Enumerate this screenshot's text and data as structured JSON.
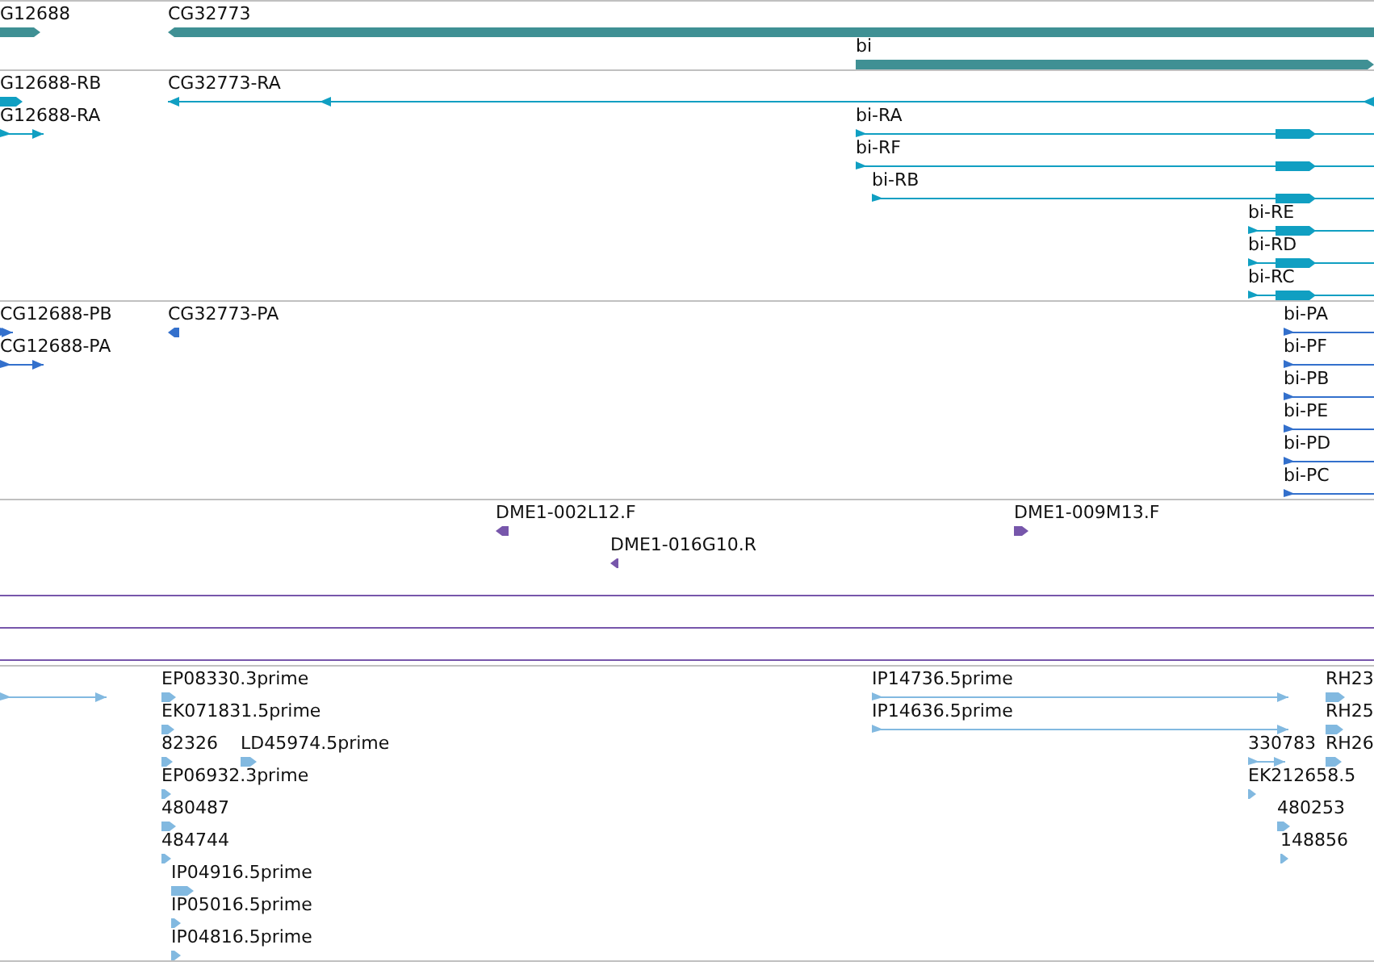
{
  "tracks": [
    {
      "color": "#3f9094",
      "features": [
        {
          "label": "G12688",
          "kind": "bar",
          "reverse": false
        },
        {
          "label": "CG32773",
          "kind": "bar",
          "reverse": true
        },
        {
          "label": "bi",
          "kind": "bar",
          "reverse": false
        }
      ]
    },
    {
      "color": "#109fc2",
      "features": [
        {
          "label": "G12688-RB",
          "kind": "bar",
          "reverse": false
        },
        {
          "label": "CG32773-RA",
          "kind": "line",
          "reverse": true
        },
        {
          "label": "G12688-RA",
          "kind": "line",
          "reverse": false
        },
        {
          "label": "bi-RA",
          "kind": "exon-line",
          "reverse": false
        },
        {
          "label": "bi-RF",
          "kind": "exon-line",
          "reverse": false
        },
        {
          "label": "bi-RB",
          "kind": "exon-line",
          "reverse": false
        },
        {
          "label": "bi-RE",
          "kind": "exon-line",
          "reverse": false
        },
        {
          "label": "bi-RD",
          "kind": "exon-line",
          "reverse": false
        },
        {
          "label": "bi-RC",
          "kind": "exon-line",
          "reverse": false
        }
      ]
    },
    {
      "color": "#3370cc",
      "features": [
        {
          "label": "CG12688-PB",
          "kind": "line",
          "reverse": false
        },
        {
          "label": "CG32773-PA",
          "kind": "bar",
          "reverse": true
        },
        {
          "label": "CG12688-PA",
          "kind": "line",
          "reverse": false
        },
        {
          "label": "bi-PA",
          "kind": "exon-line",
          "reverse": false
        },
        {
          "label": "bi-PF",
          "kind": "exon-line",
          "reverse": false
        },
        {
          "label": "bi-PB",
          "kind": "exon-line",
          "reverse": false
        },
        {
          "label": "bi-PE",
          "kind": "exon-line",
          "reverse": false
        },
        {
          "label": "bi-PD",
          "kind": "exon-line",
          "reverse": false
        },
        {
          "label": "bi-PC",
          "kind": "exon-line",
          "reverse": false
        }
      ]
    },
    {
      "color": "#7756ab",
      "features": [
        {
          "label": "DME1-002L12.F",
          "kind": "bar",
          "reverse": true
        },
        {
          "label": "DME1-009M13.F",
          "kind": "bar",
          "reverse": false
        },
        {
          "label": "DME1-016G10.R",
          "kind": "bar",
          "reverse": true
        },
        {
          "kind": "plain-line"
        },
        {
          "kind": "plain-line"
        },
        {
          "kind": "plain-line"
        }
      ]
    },
    {
      "color": "#82b9e0",
      "features": [
        {
          "kind": "line",
          "reverse": false
        },
        {
          "label": "EP08330.3prime",
          "kind": "bar",
          "reverse": false
        },
        {
          "label": "IP14736.5prime",
          "kind": "line",
          "reverse": false
        },
        {
          "label": "RH23",
          "kind": "bar",
          "reverse": false
        },
        {
          "label": "EK071831.5prime",
          "kind": "bar",
          "reverse": false
        },
        {
          "label": "IP14636.5prime",
          "kind": "line",
          "reverse": false
        },
        {
          "label": "RH25",
          "kind": "bar",
          "reverse": false
        },
        {
          "label": "82326",
          "kind": "bar",
          "reverse": false
        },
        {
          "label": "LD45974.5prime",
          "kind": "bar",
          "reverse": false
        },
        {
          "label": "330783",
          "kind": "line",
          "reverse": false
        },
        {
          "label": "RH26",
          "kind": "bar",
          "reverse": false
        },
        {
          "label": "EP06932.3prime",
          "kind": "bar",
          "reverse": false
        },
        {
          "label": "EK212658.5",
          "kind": "bar",
          "reverse": false
        },
        {
          "label": "480487",
          "kind": "bar",
          "reverse": false
        },
        {
          "label": "480253",
          "kind": "bar",
          "reverse": false
        },
        {
          "label": "484744",
          "kind": "bar",
          "reverse": false
        },
        {
          "label": "148856",
          "kind": "bar",
          "reverse": false
        },
        {
          "label": "IP04916.5prime",
          "kind": "bar",
          "reverse": false
        },
        {
          "label": "IP05016.5prime",
          "kind": "bar",
          "reverse": false
        },
        {
          "label": "IP04816.5prime",
          "kind": "bar",
          "reverse": false
        }
      ]
    }
  ]
}
